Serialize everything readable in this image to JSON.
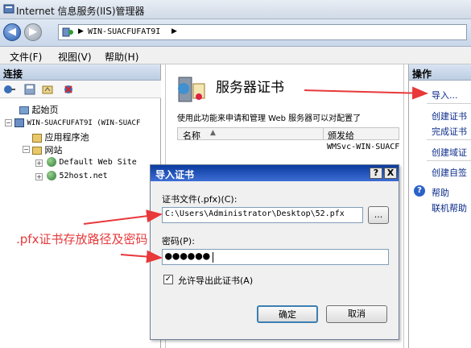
{
  "window": {
    "title": "Internet 信息服务(IIS)管理器"
  },
  "address": {
    "host": "WIN-SUACFUFAT9I"
  },
  "menu": {
    "file": "文件(F)",
    "view": "视图(V)",
    "help": "帮助(H)"
  },
  "left_pane": {
    "header": "连接",
    "tree": {
      "start": "起始页",
      "server": "WIN-SUACFUFAT9I (WIN-SUACF",
      "app_pool": "应用程序池",
      "sites": "网站",
      "site1": "Default Web Site",
      "site2": "52host.net"
    }
  },
  "center": {
    "title": "服务器证书",
    "description": "使用此功能来申请和管理 Web 服务器可以对配置了",
    "col_name": "名称",
    "col_issuer": "颁发给",
    "row_issuer": "WMSvc-WIN-SUACF"
  },
  "right_pane": {
    "header": "操作",
    "import": "导入...",
    "create_request": "创建证书",
    "complete_request": "完成证书",
    "create_domain": "创建域证",
    "create_self": "创建自签",
    "help": "帮助",
    "online_help": "联机帮助"
  },
  "dialog": {
    "title": "导入证书",
    "help_btn": "?",
    "close_btn": "X",
    "file_label": "证书文件(.pfx)(C):",
    "file_value": "C:\\Users\\Administrator\\Desktop\\52.pfx",
    "browse": "...",
    "password_label": "密码(P):",
    "password_mask": "●●●●●●",
    "allow_export": "允许导出此证书(A)",
    "ok": "确定",
    "cancel": "取消"
  },
  "annotation": {
    "text": ".pfx证书存放路径及密码"
  },
  "colors": {
    "annotation": "#e8383a",
    "titlebar": "#0a3b9e"
  }
}
